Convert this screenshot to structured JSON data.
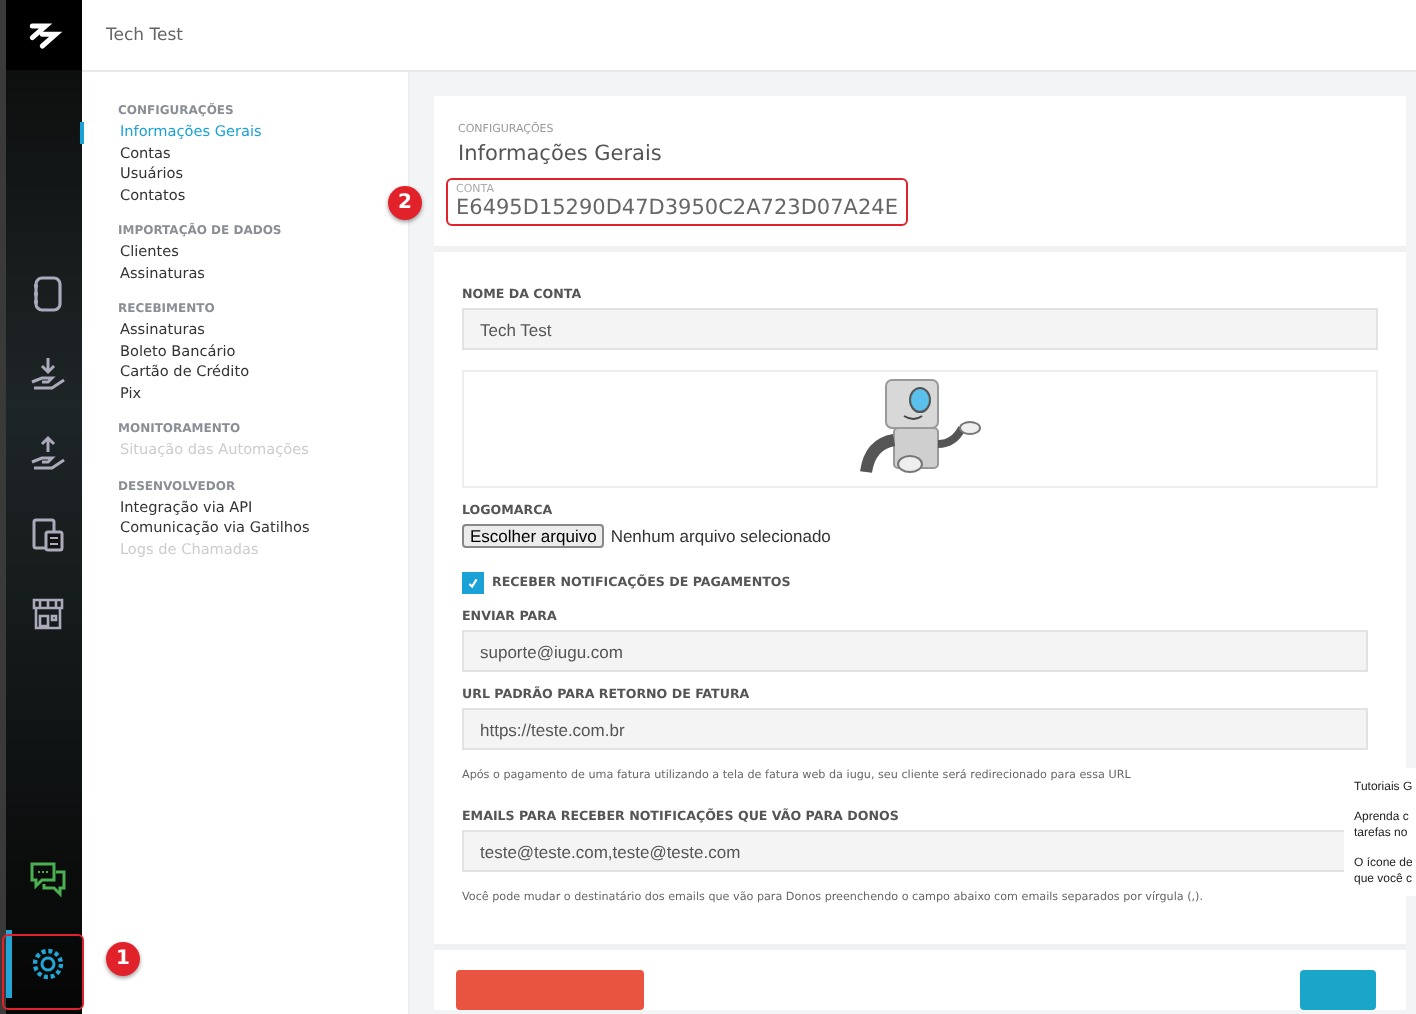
{
  "header": {
    "title": "Tech Test"
  },
  "rail": {
    "top": [
      {
        "kind": "notebook",
        "selected": false
      },
      {
        "kind": "receive",
        "selected": false
      },
      {
        "kind": "send",
        "selected": false
      },
      {
        "kind": "calculator",
        "selected": false
      },
      {
        "kind": "store",
        "selected": false
      }
    ],
    "bottom": [
      {
        "kind": "chat",
        "selected": false
      },
      {
        "kind": "settings",
        "selected": true
      }
    ]
  },
  "submenu": [
    {
      "heading": "CONFIGURAÇÕES",
      "items": [
        {
          "label": "Informações Gerais",
          "selected": true,
          "disabled": false
        },
        {
          "label": "Contas",
          "selected": false,
          "disabled": false
        },
        {
          "label": "Usuários",
          "selected": false,
          "disabled": false
        },
        {
          "label": "Contatos",
          "selected": false,
          "disabled": false
        }
      ]
    },
    {
      "heading": "IMPORTAÇÃO DE DADOS",
      "items": [
        {
          "label": "Clientes",
          "selected": false,
          "disabled": false
        },
        {
          "label": "Assinaturas",
          "selected": false,
          "disabled": false
        }
      ]
    },
    {
      "heading": "RECEBIMENTO",
      "items": [
        {
          "label": "Assinaturas",
          "selected": false,
          "disabled": false
        },
        {
          "label": "Boleto Bancário",
          "selected": false,
          "disabled": false
        },
        {
          "label": "Cartão de Crédito",
          "selected": false,
          "disabled": false
        },
        {
          "label": "Pix",
          "selected": false,
          "disabled": false
        }
      ]
    },
    {
      "heading": "MONITORAMENTO",
      "items": [
        {
          "label": "Situação das Automações",
          "selected": false,
          "disabled": true
        }
      ]
    },
    {
      "heading": "DESENVOLVEDOR",
      "items": [
        {
          "label": "Integração via API",
          "selected": false,
          "disabled": false
        },
        {
          "label": "Comunicação via Gatilhos",
          "selected": false,
          "disabled": false
        },
        {
          "label": "Logs de Chamadas",
          "selected": false,
          "disabled": true
        }
      ]
    }
  ],
  "page": {
    "breadcrumb": "CONFIGURAÇÕES",
    "title": "Informações Gerais",
    "account_label": "CONTA",
    "account_id": "E6495D15290D47D3950C2A723D07A24E"
  },
  "form": {
    "account_name": {
      "label": "NOME DA CONTA",
      "value": "Tech Test"
    },
    "logo": {
      "label": "LOGOMARCA",
      "button": "Escolher arquivo",
      "status": "Nenhum arquivo selecionado"
    },
    "notifications": {
      "label": "RECEBER NOTIFICAÇÕES DE PAGAMENTOS",
      "checked": true
    },
    "send_to": {
      "label": "ENVIAR PARA",
      "value": "suporte@iugu.com"
    },
    "return_url": {
      "label": "URL PADRÃO PARA RETORNO DE FATURA",
      "value": "https://teste.com.br",
      "help": "Após o pagamento de uma fatura utilizando a tela de fatura web da iugu, seu cliente será redirecionado para essa URL"
    },
    "owner_emails": {
      "label": "EMAILS PARA RECEBER NOTIFICAÇÕES QUE VÃO PARA DONOS",
      "value": "teste@teste.com,teste@teste.com",
      "help": "Você pode mudar o destinatário dos emails que vão para Donos preenchendo o campo abaixo com emails separados por vírgula (,)."
    }
  },
  "tooltip": {
    "title": "Tutoriais G",
    "lines": [
      "Aprenda c",
      "tarefas no",
      "O ícone de",
      "que você c"
    ]
  },
  "annotations": {
    "settings": "1",
    "account": "2"
  }
}
